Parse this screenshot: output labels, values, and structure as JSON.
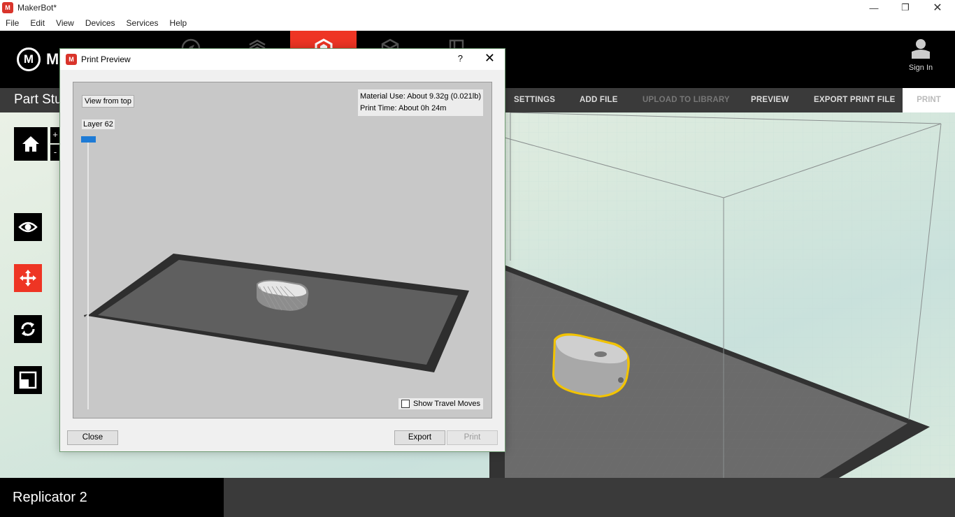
{
  "window": {
    "title": "MakerBot*",
    "app_icon": "makerbot-app-icon"
  },
  "menu": [
    "File",
    "Edit",
    "View",
    "Devices",
    "Services",
    "Help"
  ],
  "nav": {
    "tabs": [
      {
        "icon": "compass-icon"
      },
      {
        "icon": "library-icon"
      },
      {
        "icon": "prepare-icon",
        "active": true
      },
      {
        "icon": "store-icon"
      },
      {
        "icon": "learn-icon"
      }
    ],
    "signin_label": "Sign In"
  },
  "subbar": {
    "title": "Part Stu",
    "items": [
      "SETTINGS",
      "ADD FILE",
      "UPLOAD TO LIBRARY",
      "PREVIEW",
      "EXPORT PRINT FILE"
    ],
    "print_label": "PRINT"
  },
  "toolbar": {
    "home_icon": "home-icon",
    "zoom_in": "+",
    "zoom_out": "-",
    "tools": [
      "eye-icon",
      "move-icon",
      "rotate-icon",
      "scale-icon"
    ],
    "active_tool": "move-icon"
  },
  "dialog": {
    "title": "Print Preview",
    "help": "?",
    "view_from_top": "View from top",
    "material_use": "Material Use: About 9.32g (0.021lb)",
    "print_time": "Print Time: About 0h 24m",
    "layer": "Layer 62",
    "layer_fraction": 1.0,
    "show_travel_moves": "Show Travel Moves",
    "show_travel_checked": false,
    "close": "Close",
    "export": "Export",
    "print": "Print"
  },
  "bottom": {
    "printer": "Replicator 2"
  },
  "colors": {
    "accent": "#ee3524",
    "slider": "#1e7bd6",
    "selection": "#f2c300"
  }
}
